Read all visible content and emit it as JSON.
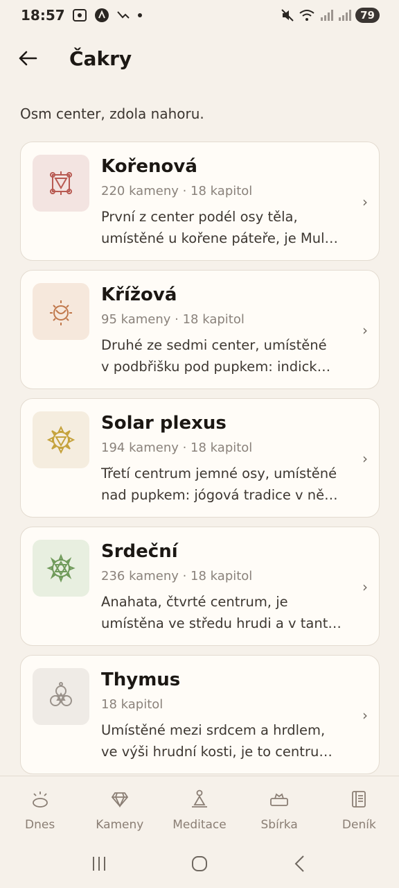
{
  "status": {
    "time": "18:57",
    "battery": "79"
  },
  "header": {
    "title": "Čakry"
  },
  "subtitle": "Osm center, zdola nahoru.",
  "chakras": [
    {
      "title": "Kořenová",
      "meta": "220 kameny · 18 kapitol",
      "desc_line1": "První z center podél osy těla,",
      "desc_line2": "umístěné u kořene páteře, je Mul…",
      "icon": "root-chakra-icon",
      "color": "#b85a52",
      "bg": "#f3e4e1"
    },
    {
      "title": "Křížová",
      "meta": "95 kameny · 18 kapitol",
      "desc_line1": "Druhé ze sedmi center, umístěné",
      "desc_line2": "v podbřišku pod pupkem: indick…",
      "icon": "sacral-chakra-icon",
      "color": "#c0774a",
      "bg": "#f6e8dc"
    },
    {
      "title": "Solar plexus",
      "meta": "194 kameny · 18 kapitol",
      "desc_line1": "Třetí centrum jemné osy, umístěné",
      "desc_line2": "nad pupkem: jógová tradice v ně…",
      "icon": "solar-plexus-chakra-icon",
      "color": "#c5a23c",
      "bg": "#f5eddf"
    },
    {
      "title": "Srdeční",
      "meta": "236 kameny · 18 kapitol",
      "desc_line1": "Anahata, čtvrté centrum, je",
      "desc_line2": "umístěna ve středu hrudi a v tant…",
      "icon": "heart-chakra-icon",
      "color": "#6f9a5a",
      "bg": "#e8efe0"
    },
    {
      "title": "Thymus",
      "meta": "18 kapitol",
      "desc_line1": "Umístěné mezi srdcem a hrdlem,",
      "desc_line2": "ve výši hrudní kosti, je to centru…",
      "icon": "thymus-chakra-icon",
      "color": "#9a928b",
      "bg": "#efebe6"
    }
  ],
  "nav": [
    {
      "label": "Dnes",
      "icon": "sun-icon"
    },
    {
      "label": "Kameny",
      "icon": "gem-icon"
    },
    {
      "label": "Meditace",
      "icon": "meditation-icon"
    },
    {
      "label": "Sbírka",
      "icon": "collection-icon"
    },
    {
      "label": "Deník",
      "icon": "journal-icon"
    }
  ]
}
